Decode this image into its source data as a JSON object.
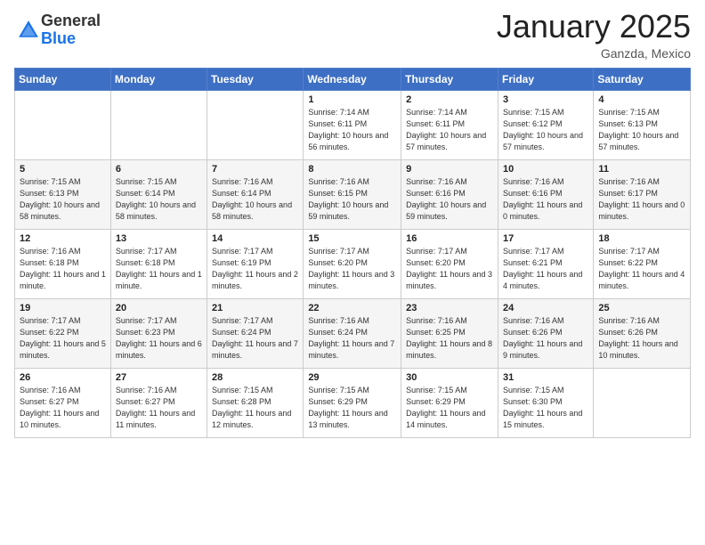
{
  "logo": {
    "general": "General",
    "blue": "Blue"
  },
  "header": {
    "month": "January 2025",
    "location": "Ganzda, Mexico"
  },
  "weekdays": [
    "Sunday",
    "Monday",
    "Tuesday",
    "Wednesday",
    "Thursday",
    "Friday",
    "Saturday"
  ],
  "weeks": [
    [
      {
        "day": "",
        "info": ""
      },
      {
        "day": "",
        "info": ""
      },
      {
        "day": "",
        "info": ""
      },
      {
        "day": "1",
        "info": "Sunrise: 7:14 AM\nSunset: 6:11 PM\nDaylight: 10 hours\nand 56 minutes."
      },
      {
        "day": "2",
        "info": "Sunrise: 7:14 AM\nSunset: 6:11 PM\nDaylight: 10 hours\nand 57 minutes."
      },
      {
        "day": "3",
        "info": "Sunrise: 7:15 AM\nSunset: 6:12 PM\nDaylight: 10 hours\nand 57 minutes."
      },
      {
        "day": "4",
        "info": "Sunrise: 7:15 AM\nSunset: 6:13 PM\nDaylight: 10 hours\nand 57 minutes."
      }
    ],
    [
      {
        "day": "5",
        "info": "Sunrise: 7:15 AM\nSunset: 6:13 PM\nDaylight: 10 hours\nand 58 minutes."
      },
      {
        "day": "6",
        "info": "Sunrise: 7:15 AM\nSunset: 6:14 PM\nDaylight: 10 hours\nand 58 minutes."
      },
      {
        "day": "7",
        "info": "Sunrise: 7:16 AM\nSunset: 6:14 PM\nDaylight: 10 hours\nand 58 minutes."
      },
      {
        "day": "8",
        "info": "Sunrise: 7:16 AM\nSunset: 6:15 PM\nDaylight: 10 hours\nand 59 minutes."
      },
      {
        "day": "9",
        "info": "Sunrise: 7:16 AM\nSunset: 6:16 PM\nDaylight: 10 hours\nand 59 minutes."
      },
      {
        "day": "10",
        "info": "Sunrise: 7:16 AM\nSunset: 6:16 PM\nDaylight: 11 hours\nand 0 minutes."
      },
      {
        "day": "11",
        "info": "Sunrise: 7:16 AM\nSunset: 6:17 PM\nDaylight: 11 hours\nand 0 minutes."
      }
    ],
    [
      {
        "day": "12",
        "info": "Sunrise: 7:16 AM\nSunset: 6:18 PM\nDaylight: 11 hours\nand 1 minute."
      },
      {
        "day": "13",
        "info": "Sunrise: 7:17 AM\nSunset: 6:18 PM\nDaylight: 11 hours\nand 1 minute."
      },
      {
        "day": "14",
        "info": "Sunrise: 7:17 AM\nSunset: 6:19 PM\nDaylight: 11 hours\nand 2 minutes."
      },
      {
        "day": "15",
        "info": "Sunrise: 7:17 AM\nSunset: 6:20 PM\nDaylight: 11 hours\nand 3 minutes."
      },
      {
        "day": "16",
        "info": "Sunrise: 7:17 AM\nSunset: 6:20 PM\nDaylight: 11 hours\nand 3 minutes."
      },
      {
        "day": "17",
        "info": "Sunrise: 7:17 AM\nSunset: 6:21 PM\nDaylight: 11 hours\nand 4 minutes."
      },
      {
        "day": "18",
        "info": "Sunrise: 7:17 AM\nSunset: 6:22 PM\nDaylight: 11 hours\nand 4 minutes."
      }
    ],
    [
      {
        "day": "19",
        "info": "Sunrise: 7:17 AM\nSunset: 6:22 PM\nDaylight: 11 hours\nand 5 minutes."
      },
      {
        "day": "20",
        "info": "Sunrise: 7:17 AM\nSunset: 6:23 PM\nDaylight: 11 hours\nand 6 minutes."
      },
      {
        "day": "21",
        "info": "Sunrise: 7:17 AM\nSunset: 6:24 PM\nDaylight: 11 hours\nand 7 minutes."
      },
      {
        "day": "22",
        "info": "Sunrise: 7:16 AM\nSunset: 6:24 PM\nDaylight: 11 hours\nand 7 minutes."
      },
      {
        "day": "23",
        "info": "Sunrise: 7:16 AM\nSunset: 6:25 PM\nDaylight: 11 hours\nand 8 minutes."
      },
      {
        "day": "24",
        "info": "Sunrise: 7:16 AM\nSunset: 6:26 PM\nDaylight: 11 hours\nand 9 minutes."
      },
      {
        "day": "25",
        "info": "Sunrise: 7:16 AM\nSunset: 6:26 PM\nDaylight: 11 hours\nand 10 minutes."
      }
    ],
    [
      {
        "day": "26",
        "info": "Sunrise: 7:16 AM\nSunset: 6:27 PM\nDaylight: 11 hours\nand 10 minutes."
      },
      {
        "day": "27",
        "info": "Sunrise: 7:16 AM\nSunset: 6:27 PM\nDaylight: 11 hours\nand 11 minutes."
      },
      {
        "day": "28",
        "info": "Sunrise: 7:15 AM\nSunset: 6:28 PM\nDaylight: 11 hours\nand 12 minutes."
      },
      {
        "day": "29",
        "info": "Sunrise: 7:15 AM\nSunset: 6:29 PM\nDaylight: 11 hours\nand 13 minutes."
      },
      {
        "day": "30",
        "info": "Sunrise: 7:15 AM\nSunset: 6:29 PM\nDaylight: 11 hours\nand 14 minutes."
      },
      {
        "day": "31",
        "info": "Sunrise: 7:15 AM\nSunset: 6:30 PM\nDaylight: 11 hours\nand 15 minutes."
      },
      {
        "day": "",
        "info": ""
      }
    ]
  ]
}
